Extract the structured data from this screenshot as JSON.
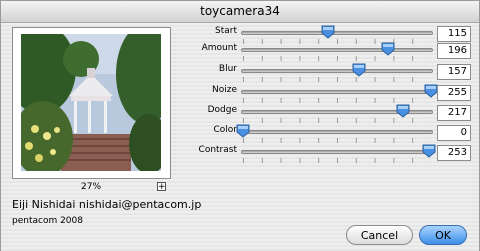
{
  "window": {
    "title": "toycamera34"
  },
  "preview": {
    "zoom_label": "27%",
    "zoom_button": "+"
  },
  "footer": {
    "author": "Eiji Nishidai nishidai@pentacom.jp",
    "copyright": "pentacom 2008"
  },
  "sliders": [
    {
      "label": "Start",
      "value": "115",
      "level": 0.451
    },
    {
      "label": "Amount",
      "value": "196",
      "level": 0.769
    },
    {
      "label": "Blur",
      "value": "157",
      "level": 0.616
    },
    {
      "label": "Noize",
      "value": "255",
      "level": 1.0
    },
    {
      "label": "Dodge",
      "value": "217",
      "level": 0.851
    },
    {
      "label": "Color",
      "value": "0",
      "level": 0.0
    },
    {
      "label": "Contrast",
      "value": "253",
      "level": 0.992
    }
  ],
  "buttons": {
    "cancel": "Cancel",
    "ok": "OK"
  },
  "colors": {
    "accent": "#3c8ee8",
    "thumb": "#4a90e2"
  }
}
